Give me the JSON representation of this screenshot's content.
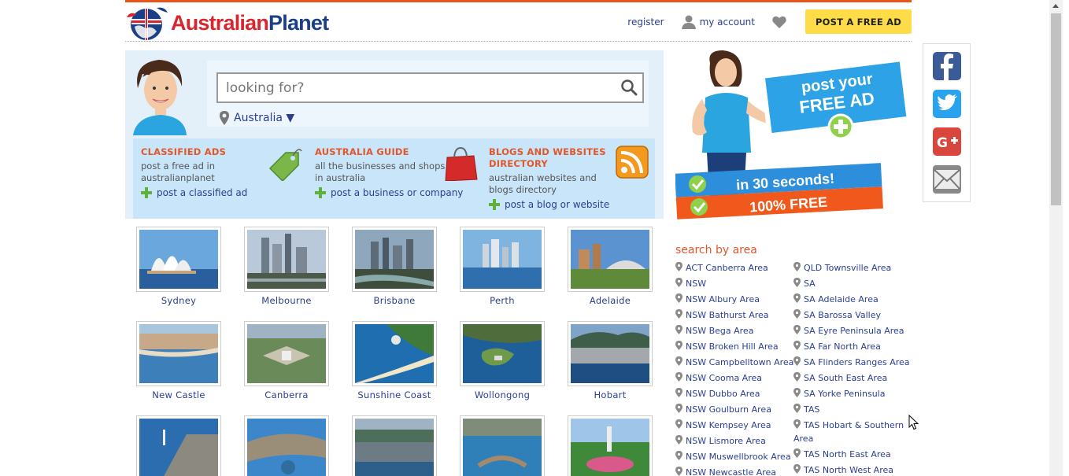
{
  "header": {
    "logo": {
      "part1": "Australian",
      "part2": "Planet"
    },
    "register": "register",
    "my_account": "my account",
    "post_ad": "POST A FREE AD"
  },
  "search": {
    "placeholder": "looking for?",
    "location": "Australia ▼"
  },
  "categories": [
    {
      "title": "CLASSIFIED ADS",
      "desc": "post a free ad in australianplanet",
      "link": "post a classified ad"
    },
    {
      "title": "AUSTRALIA GUIDE",
      "desc": "all the businesses and shops in australia",
      "link": "post a business or company"
    },
    {
      "title": "BLOGS AND WEBSITES DIRECTORY",
      "desc": "australian websites and blogs directory",
      "link": "post a blog or website"
    }
  ],
  "cities": [
    "Sydney",
    "Melbourne",
    "Brisbane",
    "Perth",
    "Adelaide",
    "New Castle",
    "Canberra",
    "Sunshine Coast",
    "Wollongong",
    "Hobart",
    "",
    "",
    "",
    "",
    ""
  ],
  "promo": {
    "line1": "post your",
    "line2": "FREE AD",
    "line3": "in 30 seconds!",
    "line4": "100% FREE"
  },
  "areas": {
    "title": "search by area",
    "col1": [
      "ACT Canberra Area",
      "NSW",
      "NSW Albury Area",
      "NSW Bathurst Area",
      "NSW Bega Area",
      "NSW Broken Hill Area",
      "NSW Campbelltown Area",
      "NSW Cooma Area",
      "NSW Dubbo Area",
      "NSW Goulburn Area",
      "NSW Kempsey Area",
      "NSW Lismore Area",
      "NSW Muswellbrook Area",
      "NSW Newcastle Area"
    ],
    "col2": [
      "QLD Townsville Area",
      "SA",
      "SA Adelaide Area",
      "SA Barossa Valley",
      "SA Eyre Peninsula Area",
      "SA Far North Area",
      "SA Flinders Ranges Area",
      "SA South East Area",
      "SA Yorke Peninsula",
      "TAS",
      "TAS Hobart & Southern",
      "TAS North East Area",
      "TAS North West Area"
    ],
    "col2_wrap": "Area"
  },
  "colors": {
    "accent": "#e8541a",
    "link": "#2a3f8f",
    "post_button": "#fddc48",
    "panel": "#e3f0fa",
    "category_bar": "#c9e5fa",
    "plus": "#5fb13b"
  },
  "icons": [
    "user-icon",
    "heart-icon",
    "search-icon",
    "map-pin-icon",
    "plus-icon",
    "tag-icon",
    "shopping-bag-icon",
    "rss-icon",
    "facebook-icon",
    "twitter-icon",
    "google-plus-icon",
    "mail-icon"
  ]
}
